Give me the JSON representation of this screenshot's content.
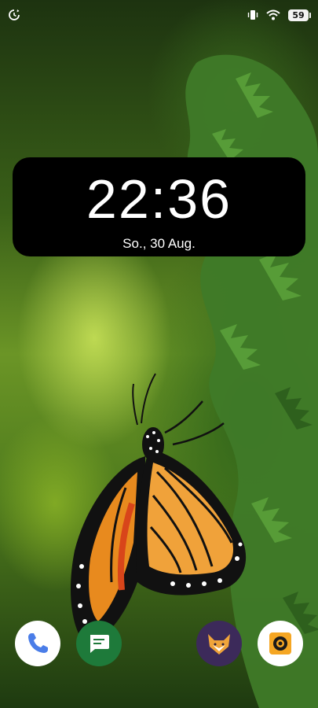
{
  "status_bar": {
    "left_icon": "sync-clock-icon",
    "icons": [
      "vibrate-icon",
      "wifi-icon"
    ],
    "battery_level": "59"
  },
  "clock_widget": {
    "time": "22:36",
    "date": "So., 30 Aug."
  },
  "wallpaper": {
    "subject": "butterfly-icon"
  },
  "dock": {
    "apps": [
      {
        "name": "phone-icon",
        "color": "#ffffff"
      },
      {
        "name": "messages-icon",
        "color": "#1e7a3a"
      },
      {
        "name": "fox-app-icon",
        "color": "#3c2a5a"
      },
      {
        "name": "camera-icon",
        "color": "#ffffff"
      }
    ]
  }
}
